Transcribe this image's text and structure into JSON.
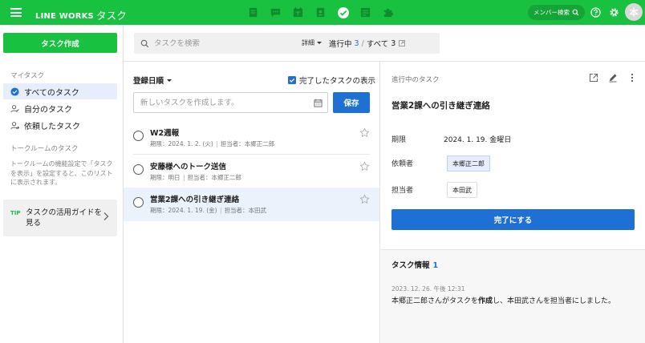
{
  "topbar": {
    "brand": "LINE WORKS",
    "brand_sub": "タスク",
    "apps": [
      "note-icon",
      "chat-icon",
      "calendar-icon",
      "contact-icon",
      "task-icon",
      "form-icon",
      "puzzle-icon"
    ],
    "member_search": "メンバー検索",
    "avatar_initial": "本",
    "accent_color": "#19c140"
  },
  "sidebar": {
    "create_button": "タスク作成",
    "my_tasks_header": "マイタスク",
    "items": [
      {
        "label": "すべてのタスク",
        "icon": "check-circle-icon",
        "active": true
      },
      {
        "label": "自分のタスク",
        "icon": "person-icon"
      },
      {
        "label": "依頼したタスク",
        "icon": "person-request-icon"
      }
    ],
    "talkroom_header": "トークルームのタスク",
    "talkroom_desc": "トークルームの機能設定で「タスクを表示」を設定すると、このリストに表示されます。",
    "tip_label": "TIP",
    "tip_text": "タスクの活用ガイドを見る"
  },
  "search": {
    "placeholder": "タスクを検索",
    "detail_label": "詳細"
  },
  "status_tabs": {
    "in_progress_label": "進行中",
    "in_progress_count": "3",
    "separator": "/",
    "all_label": "すべて",
    "all_count": "3"
  },
  "list": {
    "sort_label": "登録日順",
    "show_done_label": "完了したタスクの表示",
    "show_done_checked": true,
    "new_task_placeholder": "新しいタスクを作成します。",
    "save_label": "保存",
    "tasks": [
      {
        "title": "W2週報",
        "due": "期限：2024. 1. 2. (火)",
        "assignee": "担当者：本郷正二郎"
      },
      {
        "title": "安藤様へのトーク送信",
        "due": "期限：明日",
        "assignee": "担当者：本郷正二郎"
      },
      {
        "title": "営業2課への引き継ぎ連絡",
        "due": "期限：2024. 1. 19. (金)",
        "assignee": "担当者：本田武"
      }
    ]
  },
  "detail": {
    "status": "進行中のタスク",
    "title": "営業2課への引き継ぎ連絡",
    "due_label": "期限",
    "due_value": "2024. 1. 19. 金曜日",
    "requester_label": "依頼者",
    "requester": "本郷正二郎",
    "assignee_label": "担当者",
    "assignee": "本田武",
    "complete_button": "完了にする",
    "info_header": "タスク情報",
    "info_count": "1",
    "log_date": "2023. 12. 26. 午後 12:31",
    "log_text_1": "本郷正二郎さんがタスクを",
    "log_text_bold": "作成",
    "log_text_2": "し、本田武さんを担当者にしました。"
  }
}
